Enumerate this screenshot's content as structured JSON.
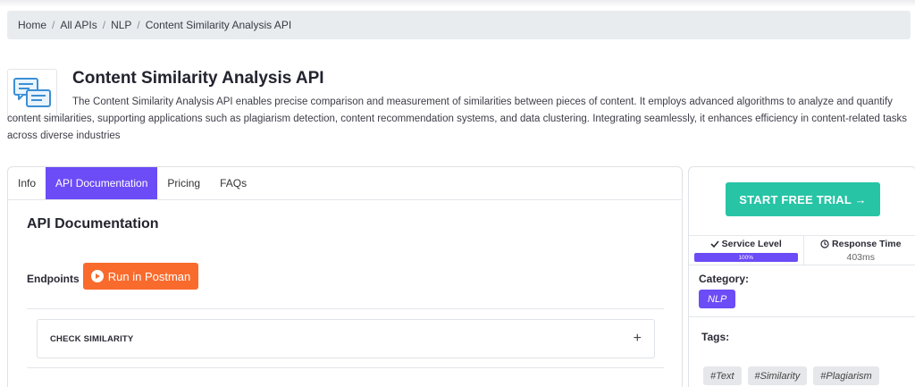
{
  "breadcrumb": {
    "items": [
      "Home",
      "All APIs",
      "NLP",
      "Content Similarity Analysis API"
    ],
    "separator": "/"
  },
  "api": {
    "logo_icon": "chat-bubbles-icon",
    "title": "Content Similarity Analysis API",
    "description": "The Content Similarity Analysis API enables precise comparison and measurement of similarities between pieces of content. It employs advanced algorithms to analyze and quantify content similarities, supporting applications such as plagiarism detection, content recommendation systems, and data clustering. Integrating seamlessly, it enhances efficiency in content-related tasks across diverse industries"
  },
  "tabs": [
    {
      "label": "Info",
      "active": false
    },
    {
      "label": "API Documentation",
      "active": true
    },
    {
      "label": "Pricing",
      "active": false
    },
    {
      "label": "FAQs",
      "active": false
    }
  ],
  "docs": {
    "title": "API Documentation",
    "endpoints_label": "Endpoints",
    "postman_button": "Run in Postman",
    "endpoints": [
      {
        "label": "CHECK SIMILARITY",
        "expand_icon": "+"
      }
    ]
  },
  "sidebar": {
    "trial_button": "START FREE TRIAL →",
    "service_level": {
      "label": "Service Level",
      "value_text": "100%",
      "value": 100
    },
    "response_time": {
      "label": "Response Time",
      "value": "403ms"
    },
    "category_label": "Category:",
    "category": "NLP",
    "tags_label": "Tags:",
    "tags": [
      "#Text",
      "#Similarity",
      "#Plagiarism"
    ]
  },
  "colors": {
    "accent": "#6c4cf6",
    "trial": "#27c4a6",
    "postman": "#f96b2d"
  }
}
